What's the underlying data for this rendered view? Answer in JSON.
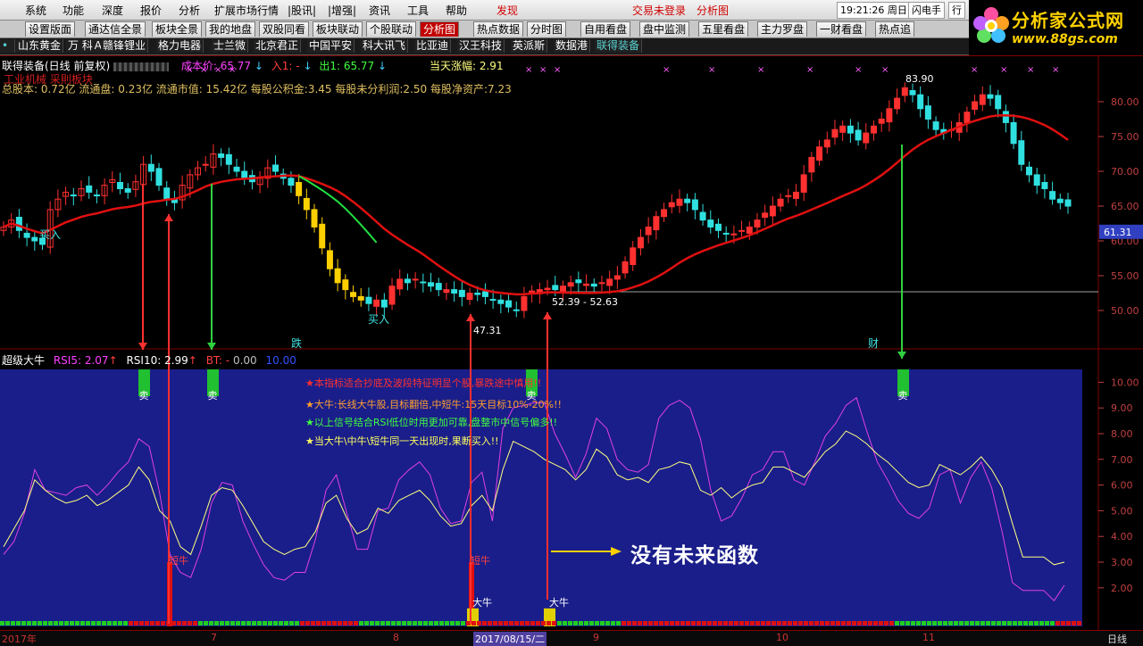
{
  "menu": {
    "items": [
      {
        "label": "系统",
        "red": false
      },
      {
        "label": "功能",
        "red": false
      },
      {
        "label": "深度",
        "red": false
      },
      {
        "label": "报价",
        "red": false
      },
      {
        "label": "分析",
        "red": false
      },
      {
        "label": "扩展市场行情",
        "red": false
      },
      {
        "label": "|股讯|",
        "red": false
      },
      {
        "label": "|增强|",
        "red": false
      },
      {
        "label": "资讯",
        "red": false
      },
      {
        "label": "工具",
        "red": false
      },
      {
        "label": "帮助",
        "red": false
      },
      {
        "label": "发现",
        "red": true
      },
      {
        "label": "交易未登录",
        "red": true
      },
      {
        "label": "分析图",
        "red": true
      }
    ],
    "clock": "19:21:26 周日",
    "flash": "闪电手",
    "extra": "行"
  },
  "logo": {
    "title": "分析家公式网",
    "url": "www.88gs.com"
  },
  "tabs": [
    "设置版面",
    "通达信全景",
    "板块全景",
    "我的地盘",
    "双股同看",
    "板块联动",
    "个股联动",
    "分析图",
    "热点数据",
    "分时图",
    "自用看盘",
    "盘中监测",
    "五里看盘",
    "主力罗盘",
    "一财看盘",
    "热点追"
  ],
  "active_tab": 7,
  "stocks": [
    "山东黄金",
    "万 科Ａ",
    "赣锋锂业",
    "格力电器",
    "士兰微",
    "北京君正",
    "中国平安",
    "科大讯飞",
    "比亚迪",
    "汉王科技",
    "英派斯",
    "数据港",
    "联得装备"
  ],
  "main": {
    "title": "联得装备(日线 前复权)",
    "cost": "成本价: 65.77",
    "in1": "入1: -",
    "out1": "出1: 65.77",
    "day_change": "当天涨幅: 2.91",
    "sector": "工业机械 采則板块",
    "fundamentals": "总股本: 0.72亿 流通盘: 0.23亿 流通市值: 15.42亿 每股公积金:3.45 每股未分利润:2.50 每股净资产:7.23",
    "price_high": "83.90",
    "price_low": "47.31",
    "range_label": "52.39 - 52.63",
    "current_price": "61.31",
    "buy_labels": [
      "买入",
      "买入"
    ],
    "mark_die": "跌",
    "mark_cai": "财",
    "yaxis": [
      "80.00",
      "75.00",
      "70.00",
      "65.00",
      "60.00",
      "55.00",
      "50.00"
    ]
  },
  "sub": {
    "title": "超级大牛",
    "rsi5": "RSI5: 2.07",
    "rsi10": "RSI10: 2.99",
    "bt": "BT: -",
    "bt_value": "0.00",
    "v10": "10.00",
    "yaxis": [
      "10.00",
      "9.00",
      "8.00",
      "7.00",
      "6.00",
      "5.00",
      "4.00",
      "3.00",
      "2.00"
    ],
    "notes": [
      "★本指标适合抄底及波段特征明显个股,暴跌途中慎用!!",
      "★大牛:长线大牛股,目标翻倍,中短牛:15天目标10%-20%!!",
      "★以上信号结合RSI低位时用更加可靠,盘整市中信号偏多!!",
      "★当大牛\\中牛\\短牛同一天出现时,果断买入!!"
    ],
    "sell_label": "卖",
    "short_bull": "短牛",
    "big_bull": "大牛",
    "no_future": "没有未来函数"
  },
  "bottom": {
    "dates": [
      "2017年",
      "7",
      "8",
      "2017/08/15/二",
      "9",
      "10",
      "11"
    ],
    "period": "日线"
  }
}
